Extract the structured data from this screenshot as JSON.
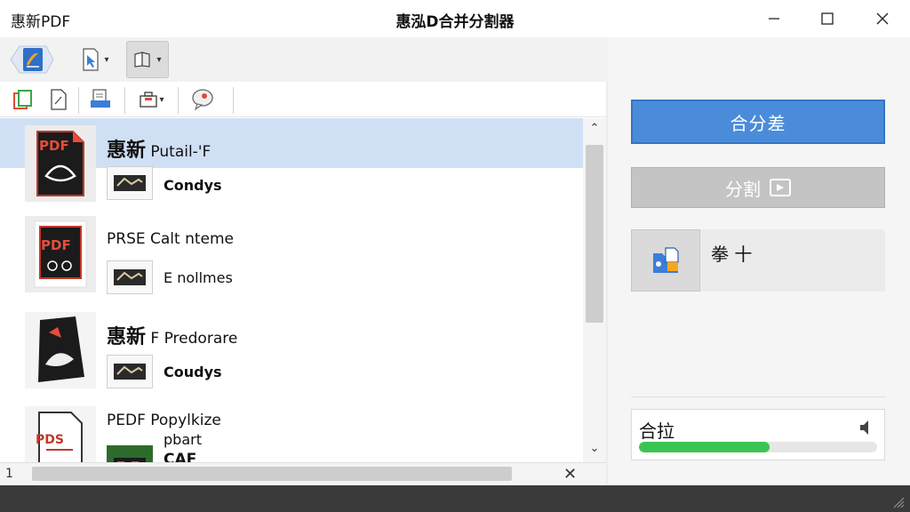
{
  "window": {
    "app_name": "惠新PDF",
    "title": "惠泓D合并分割器",
    "controls": {
      "minimize": "—",
      "maximize": "☐",
      "close": "✕"
    }
  },
  "toolbar": {
    "logo_icon": "pdf-logo-icon",
    "pointer_icon": "cursor-pointer-icon",
    "book_icon": "open-book-icon",
    "dropdown_glyph": "▾"
  },
  "toolbar2": {
    "icons": [
      "copy-pages-icon",
      "blank-page-icon",
      "stack-pages-icon",
      "briefcase-icon",
      "chat-bubble-icon"
    ]
  },
  "files": [
    {
      "title_big": "惠新",
      "title": "Putail-'F",
      "sub_label": "Condys",
      "thumb_text": "PDF",
      "selected": true
    },
    {
      "title_big": "",
      "title": "PRSE Calt nteme",
      "sub_label": "E nollmes",
      "thumb_text": "PDF",
      "selected": false
    },
    {
      "title_big": "惠新",
      "title": "F Predorare",
      "sub_label": "Coudys",
      "thumb_text": "",
      "selected": false
    },
    {
      "title_big": "",
      "title": "PEDF Popylkize",
      "sub_label": "pbart",
      "sub_label2": "CAF",
      "thumb_text": "PDS",
      "selected": false
    }
  ],
  "scroll": {
    "up": "⌃",
    "down": "⌄",
    "h_left": "1",
    "h_close": "✕"
  },
  "right_panel": {
    "merge_button": "合分差",
    "split_button": "分割",
    "option_label": "拳 十",
    "progress_label": "合拉",
    "progress_fraction": 0.55,
    "progress_color": "#3cc453",
    "accent_color": "#4a8cd9"
  }
}
